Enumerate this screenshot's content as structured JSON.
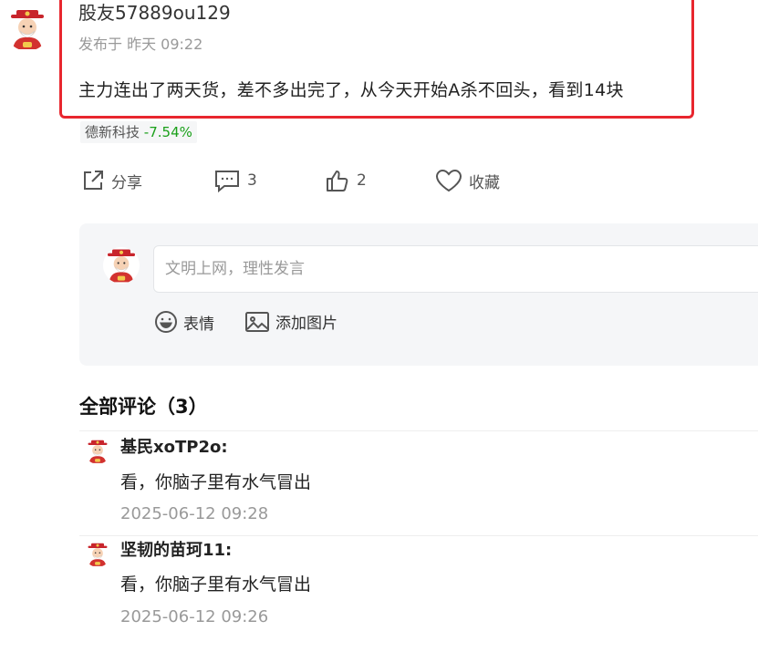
{
  "post": {
    "author": "股友57889ou129",
    "time": "发布于 昨天 09:22",
    "content": "主力连出了两天货，差不多出完了，从今天开始A杀不回头，看到14块"
  },
  "stock_tag": {
    "name": "德新科技",
    "change": "-7.54%"
  },
  "actions": {
    "share_label": "分享",
    "comment_count": "3",
    "like_count": "2",
    "favorite_label": "收藏"
  },
  "comment_box": {
    "placeholder": "文明上网，理性发言",
    "emoji_label": "表情",
    "image_label": "添加图片"
  },
  "comments_section": {
    "title": "全部评论（3）",
    "items": [
      {
        "name": "基民xoTP2o:",
        "text": "看，你脑子里有水气冒出",
        "time": "2025-06-12 09:28"
      },
      {
        "name": "坚韧的苗珂11:",
        "text": "看，你脑子里有水气冒出",
        "time": "2025-06-12 09:26"
      }
    ]
  },
  "colors": {
    "highlight": "#e8262e",
    "stock_down": "#1aa01a"
  }
}
